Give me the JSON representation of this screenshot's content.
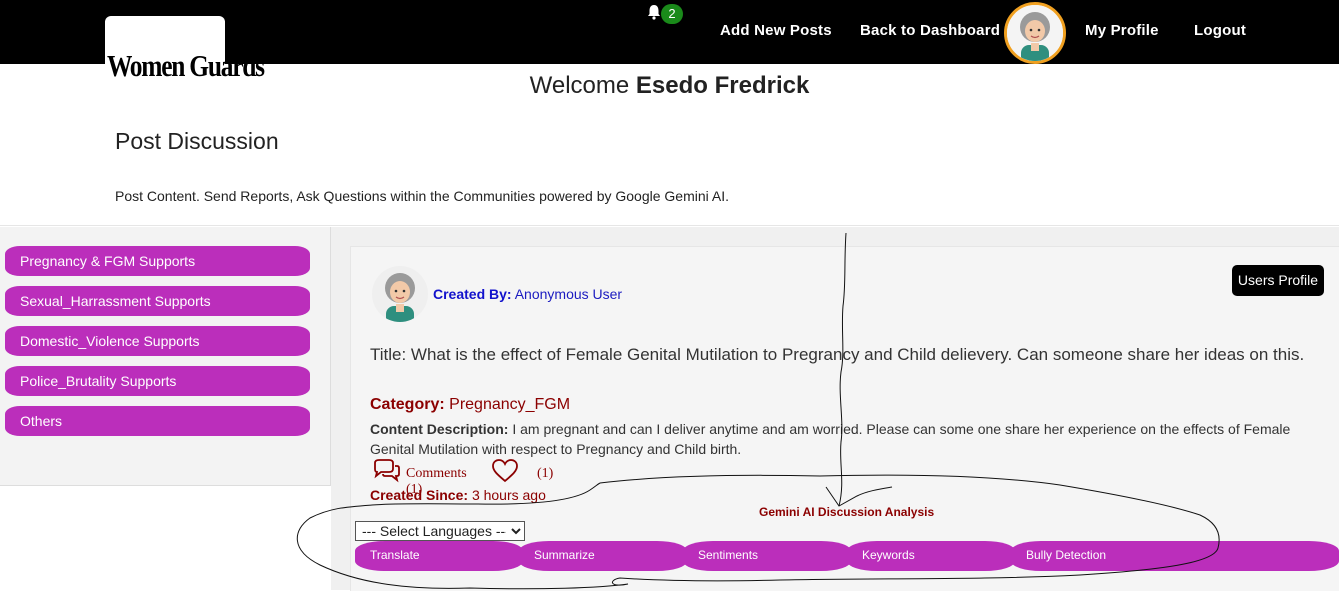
{
  "navbar": {
    "logo_text": "Women Guards",
    "notification_count": "2",
    "links": {
      "add_posts": "Add New Posts",
      "dashboard": "Back to Dashboard",
      "profile": "My Profile",
      "logout": "Logout"
    }
  },
  "header": {
    "welcome_prefix": "Welcome",
    "user_name": "Esedo Fredrick",
    "page_title": "Post Discussion",
    "page_subtitle": "Post Content. Send Reports, Ask Questions within the Communities powered by Google Gemini AI."
  },
  "sidebar": {
    "items": [
      {
        "label": "Pregnancy & FGM Supports"
      },
      {
        "label": "Sexual_Harrassment Supports"
      },
      {
        "label": "Domestic_Violence Supports"
      },
      {
        "label": "Police_Brutality Supports"
      },
      {
        "label": "Others"
      }
    ]
  },
  "post": {
    "created_by_label": "Created By:",
    "created_by_value": "Anonymous User",
    "users_profile_button": "Users Profile",
    "title": "Title: What is the effect of Female Genital Mutilation to Pregrancy and Child delievery. Can someone share her ideas on this.",
    "category_label": "Category:",
    "category_value": "Pregnancy_FGM",
    "description_label": "Content Description:",
    "description_value": "I am pregnant and can I deliver anytime and am worried. Please can some one share her experience on the effects of Female Genital Mutilation with respect to Pregnancy and Child birth.",
    "comments_label": "Comments (1)",
    "likes_count": "(1)",
    "created_since_label": "Created Since:",
    "created_since_value": "3 hours ago"
  },
  "ai_tools": {
    "heading": "Gemini AI Discussion Analysis",
    "language_select": "--- Select Languages ---",
    "buttons": [
      "Translate",
      "Summarize",
      "Sentiments",
      "Keywords",
      "Bully Detection"
    ]
  },
  "colors": {
    "navbar_bg": "#000000",
    "accent_purple": "#bb2ebb",
    "category_red": "#8b0000",
    "link_blue": "#1111cc",
    "badge_green": "#1a8a1a",
    "avatar_ring": "#f0a020"
  },
  "icons": {
    "bell": "bell-icon",
    "comment": "comment-icon",
    "heart": "heart-icon"
  }
}
